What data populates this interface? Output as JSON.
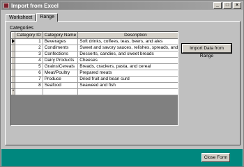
{
  "window": {
    "title": "Import from Excel",
    "controls": [
      "_",
      "□",
      "×"
    ]
  },
  "tabs": [
    {
      "label": "Worksheet",
      "active": false
    },
    {
      "label": "Range",
      "active": true
    }
  ],
  "categories": {
    "label": "Categories",
    "columns": [
      "Category ID",
      "Category Name",
      "Description"
    ],
    "rows": [
      {
        "id": "1",
        "name": "Beverages",
        "description": "Soft drinks, coffees, teas, beers, and ales"
      },
      {
        "id": "2",
        "name": "Condiments",
        "description": "Sweet and savory sauces, relishes, spreads, and seaso"
      },
      {
        "id": "3",
        "name": "Confections",
        "description": "Desserts, candies, and sweet breads"
      },
      {
        "id": "4",
        "name": "Dairy Products",
        "description": "Cheeses"
      },
      {
        "id": "5",
        "name": "Grains/Cereals",
        "description": "Breads, crackers, pasta, and cereal"
      },
      {
        "id": "6",
        "name": "Meat/Poultry",
        "description": "Prepared meats"
      },
      {
        "id": "7",
        "name": "Produce",
        "description": "Dried fruit and bean curd"
      },
      {
        "id": "8",
        "name": "Seafood",
        "description": "Seaweed and fish"
      }
    ],
    "new_row_marker": "*"
  },
  "buttons": {
    "import": "Import Data from Range",
    "close": "Close Form"
  },
  "colors": {
    "footer": "#00877e",
    "titlebar": "#808080"
  }
}
